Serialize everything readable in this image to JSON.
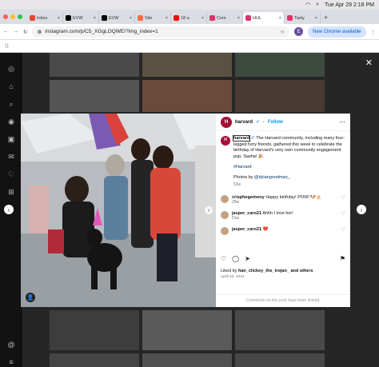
{
  "menubar": {
    "datetime": "Tue Apr 29  2:18 PM"
  },
  "tabs": [
    {
      "label": "Inbox",
      "favicon_color": "#ea4335"
    },
    {
      "label": "EVW",
      "favicon_color": "#000000"
    },
    {
      "label": "EVW",
      "favicon_color": "#000000"
    },
    {
      "label": "Site",
      "favicon_color": "#ff6b3d"
    },
    {
      "label": "18 a",
      "favicon_color": "#ff0000"
    },
    {
      "label": "Com",
      "favicon_color": "#e1306c"
    },
    {
      "label": "HUL",
      "favicon_color": "#e1306c"
    },
    {
      "label": "Tasty",
      "favicon_color": "#e1306c"
    }
  ],
  "address": {
    "url": "instagram.com/p/C5_XGgLOQWE/?img_index=1",
    "new_chrome_label": "New Chrome available",
    "profile_initial": "E"
  },
  "post": {
    "username": "harvard",
    "follow_label": "Follow",
    "caption_user": "harvard",
    "caption_text": "The Harvard community, including many four-legged furry friends, gathered this week to celebrate the birthday of Harvard's very own community engagement pup, Sasha! 🎉",
    "hashtag": "#Harvard",
    "photo_credit_prefix": "Photos by ",
    "photo_credit_user": "@dylangoodman_",
    "caption_age": "53w",
    "comments": [
      {
        "user": "crisphegemony",
        "text": "Happy birthday! POW! 🐶🎂",
        "age": "29w"
      },
      {
        "user": "jasper_caro21",
        "text": "Ahhh I love her!",
        "age": "51w"
      },
      {
        "user": "jasper_caro21",
        "text": "❤️",
        "age": ""
      }
    ],
    "liked_by_prefix": "Liked by ",
    "liked_by_user": "han_clickey_the_trojan_",
    "liked_by_suffix": " and others",
    "date": "April 20, 2024",
    "comments_limited": "Comments on this post have been limited."
  }
}
